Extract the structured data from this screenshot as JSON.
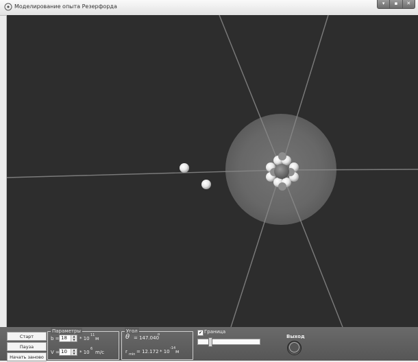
{
  "window": {
    "title": "Моделирование опыта Резерфорда",
    "controls": [
      "▾",
      "▪",
      "✕"
    ]
  },
  "scene": {
    "background": "#2d2d2d",
    "atom_color": "#6a6a6a",
    "particle_color": "#f2f2f2"
  },
  "buttons": {
    "start": "Старт",
    "pause": "Пауза",
    "restart": "Начать заново",
    "exit": "Выход"
  },
  "params": {
    "legend": "Параметры",
    "b_label": "b =",
    "b_value": "18",
    "b_unit": "* 10",
    "b_exp": "11",
    "b_m": "м",
    "v_label": "V =",
    "v_value": "10",
    "v_unit": "* 10",
    "v_exp": "6",
    "v_ms": "m/c"
  },
  "angle": {
    "legend": "Угол",
    "theta_symbol": "θ",
    "theta_text": "= 147.040",
    "theta_deg": "o",
    "rmin_symbol": "r",
    "rmin_sub": "min",
    "rmin_text": "= 12.172",
    "rmin_unit": "* 10",
    "rmin_exp": "-14",
    "rmin_m": "м"
  },
  "boundary": {
    "label": "Граница",
    "checked": true,
    "check_mark": "✔",
    "slider_fraction": 0.18
  }
}
